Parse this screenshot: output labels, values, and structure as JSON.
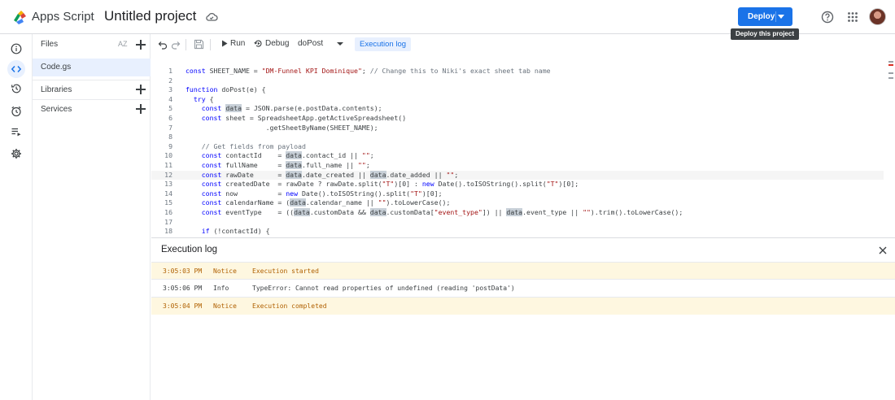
{
  "header": {
    "app_name": "Apps Script",
    "project_title": "Untitled project",
    "deploy_label": "Deploy",
    "deploy_tooltip": "Deploy this project"
  },
  "files_panel": {
    "title": "Files",
    "sort_label": "AZ",
    "files": [
      {
        "name": "Code.gs"
      }
    ],
    "sections": [
      {
        "label": "Libraries"
      },
      {
        "label": "Services"
      }
    ]
  },
  "toolbar": {
    "run_label": "Run",
    "debug_label": "Debug",
    "function_name": "doPost",
    "execution_log_label": "Execution log"
  },
  "editor": {
    "current_line": 12,
    "lines": [
      {
        "n": "1",
        "html": "<span class='kw'>const</span> SHEET_NAME = <span class='str'>\"DM-Funnel KPI Dominique\"</span>; <span class='cmt'>// Change this to Niki's exact sheet tab name</span>"
      },
      {
        "n": "2",
        "html": ""
      },
      {
        "n": "3",
        "html": "<span class='kw'>function</span> doPost(e) {"
      },
      {
        "n": "4",
        "html": "  <span class='kw'>try</span> {"
      },
      {
        "n": "5",
        "html": "    <span class='kw'>const</span> <span class='hl'>data</span> = JSON.parse(e.postData.contents);"
      },
      {
        "n": "6",
        "html": "    <span class='kw'>const</span> sheet = SpreadsheetApp.getActiveSpreadsheet()"
      },
      {
        "n": "7",
        "html": "                    .getSheetByName(SHEET_NAME);"
      },
      {
        "n": "8",
        "html": ""
      },
      {
        "n": "9",
        "html": "    <span class='cmt'>// Get fields from payload</span>"
      },
      {
        "n": "10",
        "html": "    <span class='kw'>const</span> contactId    = <span class='hl'>data</span>.contact_id || <span class='str'>\"\"</span>;"
      },
      {
        "n": "11",
        "html": "    <span class='kw'>const</span> fullName     = <span class='hl'>data</span>.full_name || <span class='str'>\"\"</span>;"
      },
      {
        "n": "12",
        "html": "    <span class='kw'>const</span> rawDate      = <span class='hl'>data</span>.date_created || <span class='hl'>data</span>.date_added || <span class='str'>\"\"</span>;"
      },
      {
        "n": "13",
        "html": "    <span class='kw'>const</span> createdDate  = rawDate ? rawDate.split(<span class='str'>\"T\"</span>)[0] : <span class='kw'>new</span> Date().toISOString().split(<span class='str'>\"T\"</span>)[0];"
      },
      {
        "n": "14",
        "html": "    <span class='kw'>const</span> now          = <span class='kw'>new</span> Date().toISOString().split(<span class='str'>\"T\"</span>)[0];"
      },
      {
        "n": "15",
        "html": "    <span class='kw'>const</span> calendarName = (<span class='hl'>data</span>.calendar_name || <span class='str'>\"\"</span>).toLowerCase();"
      },
      {
        "n": "16",
        "html": "    <span class='kw'>const</span> eventType    = ((<span class='hl'>data</span>.customData &amp;&amp; <span class='hl'>data</span>.customData[<span class='str'>\"event_type\"</span>]) || <span class='hl'>data</span>.event_type || <span class='str'>\"\"</span>).trim().toLowerCase();"
      },
      {
        "n": "17",
        "html": ""
      },
      {
        "n": "18",
        "html": "    <span class='kw'>if</span> (!contactId) {"
      }
    ]
  },
  "execution_log": {
    "title": "Execution log",
    "entries": [
      {
        "time": "3:05:03 PM",
        "level": "Notice",
        "message": "Execution started",
        "kind": "notice"
      },
      {
        "time": "3:05:06 PM",
        "level": "Info",
        "message": "TypeError: Cannot read properties of undefined (reading 'postData')",
        "kind": "info"
      },
      {
        "time": "3:05:04 PM",
        "level": "Notice",
        "message": "Execution completed",
        "kind": "notice"
      }
    ]
  },
  "colors": {
    "accent": "#1a73e8",
    "notice_bg": "#fef7e0",
    "notice_text": "#b06000",
    "selected_bg": "#e8f0fe"
  },
  "icons": [
    "apps-script-logo-icon",
    "cloud-saved-icon",
    "help-icon",
    "apps-grid-icon",
    "info-icon",
    "code-icon",
    "history-icon",
    "clock-icon",
    "list-run-icon",
    "settings-icon",
    "undo-icon",
    "redo-icon",
    "save-icon",
    "play-icon",
    "debug-icon",
    "close-icon"
  ]
}
